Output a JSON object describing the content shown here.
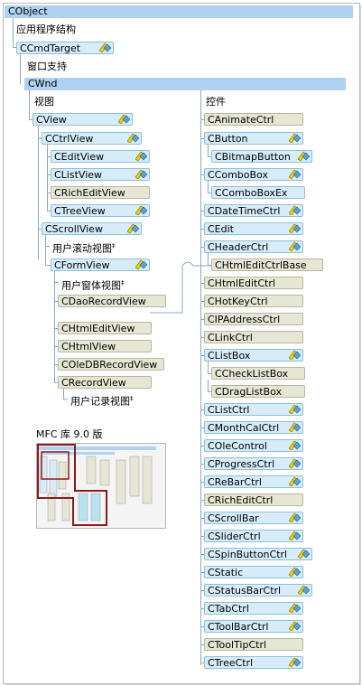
{
  "root": {
    "label": "CObject"
  },
  "groups": {
    "app_architecture": "应用程序结构",
    "window_support": "窗口支持",
    "views": "视图",
    "controls": "控件",
    "user_scroll_views": "用户滚动视图",
    "user_form_views": "用户窗体视图",
    "user_record_views": "用户记录视图",
    "footnote_mark": "‡"
  },
  "top": {
    "cmdtarget": "CCmdTarget",
    "wnd": "CWnd"
  },
  "views": {
    "cview": "CView",
    "cctrlview": "CCtrlView",
    "ceditview": "CEditView",
    "clistview": "CListView",
    "crichedit": "CRichEditView",
    "ctreeview": "CTreeView",
    "cscrollview": "CScrollView",
    "cformview": "CFormView",
    "cdaorecordview": "CDaoRecordView",
    "chtmleditview": "CHtmlEditView",
    "chtmlview": "CHtmlView",
    "coledbrecordview": "COleDBRecordView",
    "crecordview": "CRecordView"
  },
  "controls": [
    "CAnimateCtrl",
    "CButton",
    "CBitmapButton",
    "CComboBox",
    "CComboBoxEx",
    "CDateTimeCtrl",
    "CEdit",
    "CHeaderCtrl",
    "CHtmlEditCtrlBase",
    "CHtmlEditCtrl",
    "CHotKeyCtrl",
    "CIPAddressCtrl",
    "CLinkCtrl",
    "CListBox",
    "CCheckListBox",
    "CDragListBox",
    "CListCtrl",
    "CMonthCalCtrl",
    "COleControl",
    "CProgressCtrl",
    "CReBarCtrl",
    "CRichEditCtrl",
    "CScrollBar",
    "CSliderCtrl",
    "CSpinButtonCtrl",
    "CStatic",
    "CStatusBarCtrl",
    "CTabCtrl",
    "CToolBarCtrl",
    "CToolTipCtrl",
    "CTreeCtrl"
  ],
  "thumbnail": {
    "caption": "MFC 库 9.0 版"
  },
  "colors": {
    "bar": "#aed1f4",
    "blue_box": "#d7ecf9",
    "gray_box": "#e6e6d5",
    "highlight": "#8b1a1a",
    "icon_yellow": "#f0d000",
    "icon_blue": "#5aa0d8"
  },
  "icons": {
    "serializable": "pencil-diamond-icon"
  }
}
